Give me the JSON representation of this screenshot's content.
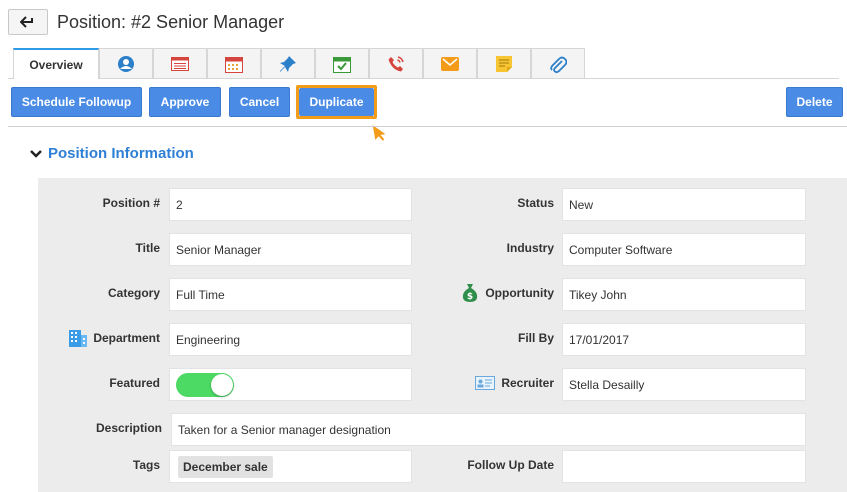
{
  "header": {
    "title": "Position: #2 Senior Manager"
  },
  "tabs": [
    {
      "label": "Overview",
      "icon": ""
    },
    {
      "label": "",
      "icon": "contacts-icon"
    },
    {
      "label": "",
      "icon": "list-icon"
    },
    {
      "label": "",
      "icon": "calendar-icon"
    },
    {
      "label": "",
      "icon": "pin-icon"
    },
    {
      "label": "",
      "icon": "task-icon"
    },
    {
      "label": "",
      "icon": "phone-icon"
    },
    {
      "label": "",
      "icon": "email-icon"
    },
    {
      "label": "",
      "icon": "note-icon"
    },
    {
      "label": "",
      "icon": "attachment-icon"
    }
  ],
  "toolbar": {
    "schedule_followup": "Schedule Followup",
    "approve": "Approve",
    "cancel": "Cancel",
    "duplicate": "Duplicate",
    "delete": "Delete"
  },
  "section": {
    "title": "Position Information"
  },
  "fields": {
    "position_no": {
      "label": "Position #",
      "value": "2"
    },
    "status": {
      "label": "Status",
      "value": "New"
    },
    "title": {
      "label": "Title",
      "value": "Senior Manager"
    },
    "industry": {
      "label": "Industry",
      "value": "Computer Software"
    },
    "category": {
      "label": "Category",
      "value": "Full Time"
    },
    "opportunity": {
      "label": "Opportunity",
      "value": "Tikey John"
    },
    "department": {
      "label": "Department",
      "value": "Engineering"
    },
    "fill_by": {
      "label": "Fill By",
      "value": "17/01/2017"
    },
    "featured": {
      "label": "Featured",
      "on": true
    },
    "recruiter": {
      "label": "Recruiter",
      "value": "Stella Desailly"
    },
    "description": {
      "label": "Description",
      "value": "Taken for a Senior manager designation"
    },
    "tags": {
      "label": "Tags",
      "value": "December sale"
    },
    "follow_up_date": {
      "label": "Follow Up Date",
      "value": ""
    }
  },
  "colors": {
    "primary_button": "#4a8be6",
    "highlight": "#f39c1a",
    "section_title": "#2e7fd6",
    "toggle_on": "#4cd964"
  }
}
